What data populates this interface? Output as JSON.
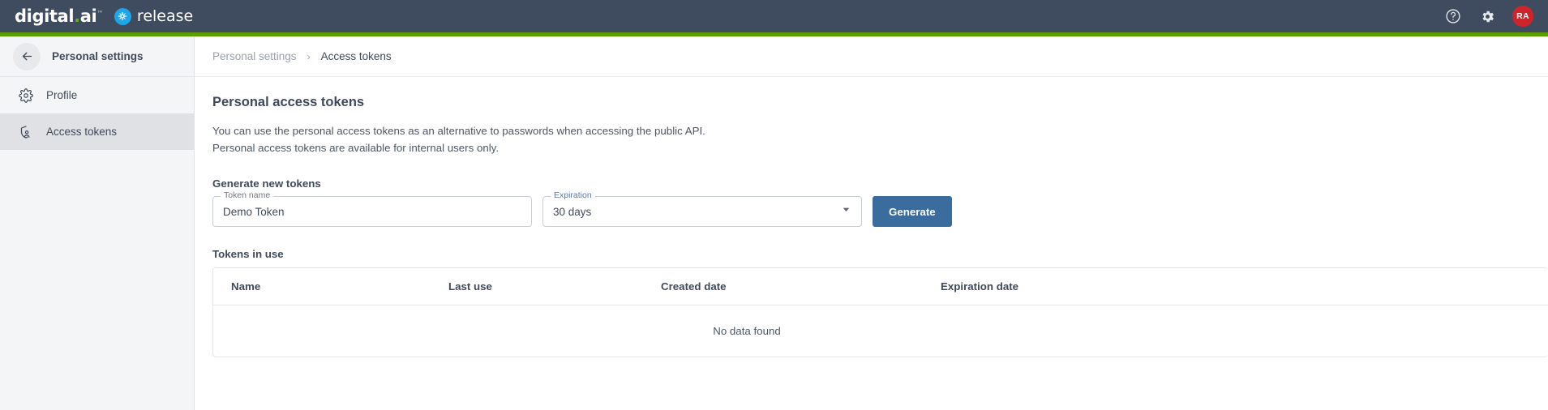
{
  "topbar": {
    "brand_primary": "digital.ai",
    "brand_product": "release",
    "help_icon": "help-circle-icon",
    "settings_icon": "gear-icon",
    "avatar_initials": "RA",
    "avatar_color": "#d1232a",
    "background_color": "#3f4c5f",
    "accent_color": "#5c9e00"
  },
  "sidebar": {
    "back_icon": "arrow-left-icon",
    "title": "Personal settings",
    "items": [
      {
        "label": "Profile",
        "icon": "gear-icon",
        "active": false
      },
      {
        "label": "Access tokens",
        "icon": "shield-person-icon",
        "active": true
      }
    ]
  },
  "breadcrumb": {
    "parent": "Personal settings",
    "separator": "›",
    "current": "Access tokens"
  },
  "main": {
    "page_title": "Personal access tokens",
    "description_line1": "You can use the personal access tokens as an alternative to passwords when accessing the public API.",
    "description_line2": "Personal access tokens are available for internal users only.",
    "generate_section_label": "Generate new tokens",
    "token_name": {
      "legend": "Token name",
      "value": "Demo Token",
      "placeholder": "Token name"
    },
    "expiration": {
      "legend": "Expiration",
      "value": "30 days",
      "caret_icon": "chevron-down-icon"
    },
    "generate_button": "Generate",
    "generate_button_color": "#3b6c9e",
    "tokens_section_label": "Tokens in use",
    "table": {
      "columns": [
        "Name",
        "Last use",
        "Created date",
        "Expiration date"
      ],
      "rows": [],
      "empty_message": "No data found"
    }
  }
}
